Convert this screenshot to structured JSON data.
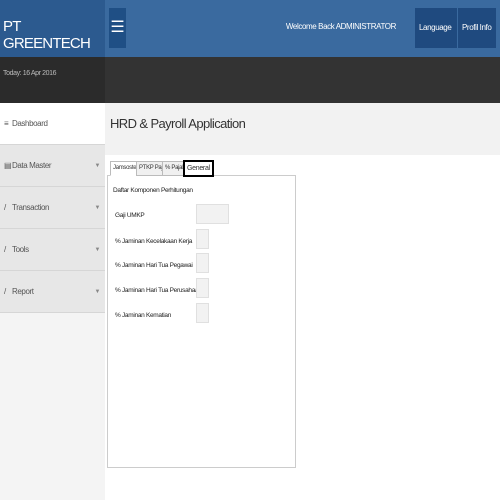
{
  "brand": "PT GREENTECH",
  "header": {
    "welcome": "Welcome Back ADMINISTRATOR",
    "language": "Language",
    "profile": "Profil Info",
    "caret": "▼"
  },
  "today": "Today: 16 Apr 2016",
  "sidebar": {
    "items": [
      {
        "label": "Dashboard",
        "icon": "≡"
      },
      {
        "label": "Data Master",
        "icon": "▤"
      },
      {
        "label": "Transaction",
        "icon": "/"
      },
      {
        "label": "Tools",
        "icon": "/"
      },
      {
        "label": "Report",
        "icon": "/"
      }
    ],
    "caret": "▼"
  },
  "page_title": "HRD & Payroll Application",
  "tabs": [
    "Jamsostek",
    "PTKP Pajak",
    "% Pajak",
    "General"
  ],
  "form": {
    "section": "Daftar Komponen Perhitungan",
    "fields": [
      {
        "label": "Gaji UMKP",
        "value": ""
      },
      {
        "label": "% Jaminan Kecelakaan Kerja",
        "value": ""
      },
      {
        "label": "% Jaminan Hari Tua Pegawai",
        "value": ""
      },
      {
        "label": "% Jaminan Hari Tua Perusahaan",
        "value": ""
      },
      {
        "label": "% Jaminan Kematian",
        "value": ""
      }
    ]
  }
}
